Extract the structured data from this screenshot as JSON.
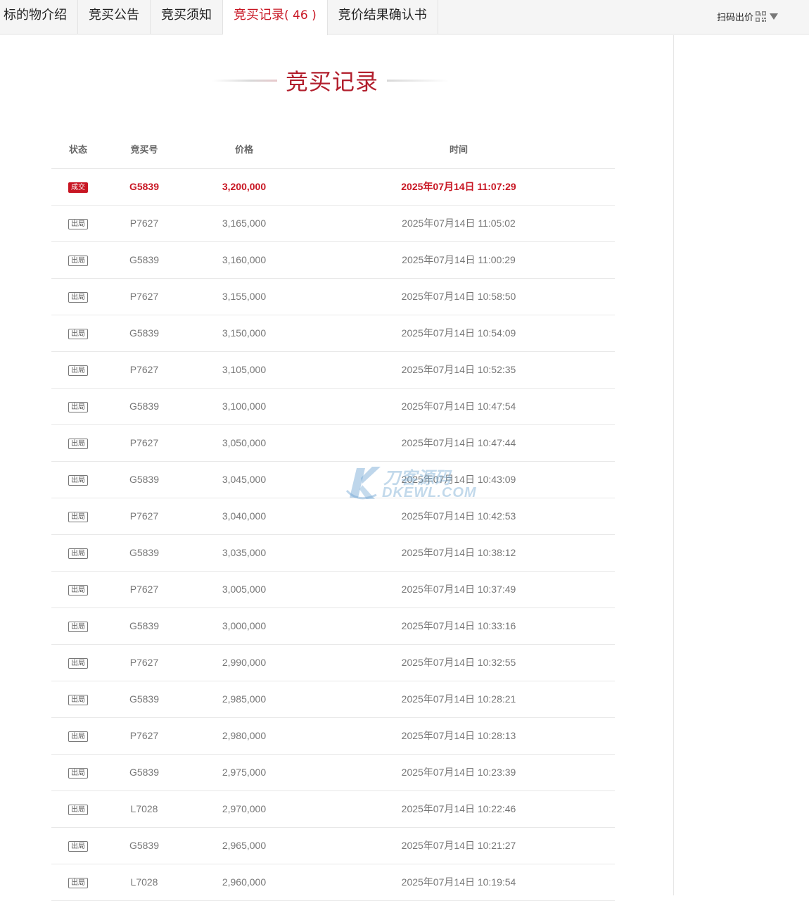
{
  "tabs": [
    {
      "label": "标的物介绍",
      "count": "",
      "active": false
    },
    {
      "label": "竞买公告",
      "count": "",
      "active": false
    },
    {
      "label": "竞买须知",
      "count": "",
      "active": false
    },
    {
      "label": "竞买记录",
      "count": "( 46 )",
      "active": true
    },
    {
      "label": "竞价结果确认书",
      "count": "",
      "active": false
    }
  ],
  "scan": {
    "label": "扫码出价"
  },
  "page_title": "竞买记录",
  "table": {
    "headers": {
      "status": "状态",
      "bidder": "竞买号",
      "price": "价格",
      "time": "时间"
    },
    "rows": [
      {
        "status": "成交",
        "bidder": "G5839",
        "price": "3,200,000",
        "time": "2025年07月14日 11:07:29",
        "winner": true
      },
      {
        "status": "出局",
        "bidder": "P7627",
        "price": "3,165,000",
        "time": "2025年07月14日 11:05:02"
      },
      {
        "status": "出局",
        "bidder": "G5839",
        "price": "3,160,000",
        "time": "2025年07月14日 11:00:29"
      },
      {
        "status": "出局",
        "bidder": "P7627",
        "price": "3,155,000",
        "time": "2025年07月14日 10:58:50"
      },
      {
        "status": "出局",
        "bidder": "G5839",
        "price": "3,150,000",
        "time": "2025年07月14日 10:54:09"
      },
      {
        "status": "出局",
        "bidder": "P7627",
        "price": "3,105,000",
        "time": "2025年07月14日 10:52:35"
      },
      {
        "status": "出局",
        "bidder": "G5839",
        "price": "3,100,000",
        "time": "2025年07月14日 10:47:54"
      },
      {
        "status": "出局",
        "bidder": "P7627",
        "price": "3,050,000",
        "time": "2025年07月14日 10:47:44"
      },
      {
        "status": "出局",
        "bidder": "G5839",
        "price": "3,045,000",
        "time": "2025年07月14日 10:43:09"
      },
      {
        "status": "出局",
        "bidder": "P7627",
        "price": "3,040,000",
        "time": "2025年07月14日 10:42:53"
      },
      {
        "status": "出局",
        "bidder": "G5839",
        "price": "3,035,000",
        "time": "2025年07月14日 10:38:12"
      },
      {
        "status": "出局",
        "bidder": "P7627",
        "price": "3,005,000",
        "time": "2025年07月14日 10:37:49"
      },
      {
        "status": "出局",
        "bidder": "G5839",
        "price": "3,000,000",
        "time": "2025年07月14日 10:33:16"
      },
      {
        "status": "出局",
        "bidder": "P7627",
        "price": "2,990,000",
        "time": "2025年07月14日 10:32:55"
      },
      {
        "status": "出局",
        "bidder": "G5839",
        "price": "2,985,000",
        "time": "2025年07月14日 10:28:21"
      },
      {
        "status": "出局",
        "bidder": "P7627",
        "price": "2,980,000",
        "time": "2025年07月14日 10:28:13"
      },
      {
        "status": "出局",
        "bidder": "G5839",
        "price": "2,975,000",
        "time": "2025年07月14日 10:23:39"
      },
      {
        "status": "出局",
        "bidder": "L7028",
        "price": "2,970,000",
        "time": "2025年07月14日 10:22:46"
      },
      {
        "status": "出局",
        "bidder": "G5839",
        "price": "2,965,000",
        "time": "2025年07月14日 10:21:27"
      },
      {
        "status": "出局",
        "bidder": "L7028",
        "price": "2,960,000",
        "time": "2025年07月14日 10:19:54"
      }
    ]
  },
  "watermark": {
    "top": "刀客源码",
    "bottom": "DKEWL.COM"
  },
  "colors": {
    "accent": "#c81623",
    "title": "#b21f2d",
    "text_muted": "#777777",
    "divider": "#e8e8e8"
  },
  "icons": {
    "qr": "qr-code-icon",
    "caret": "caret-down-icon"
  }
}
